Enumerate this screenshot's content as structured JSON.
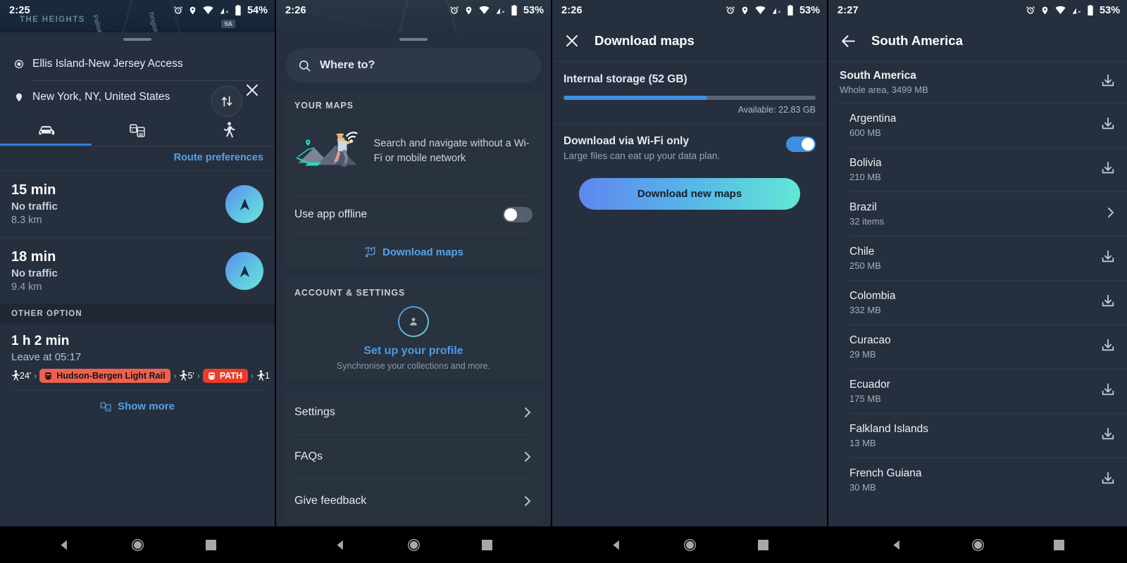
{
  "status_bars": [
    {
      "time": "2:25",
      "battery": "54%",
      "icons": [
        "alarm-icon",
        "location-icon",
        "wifi-icon",
        "cell-signal-off-icon",
        "battery-icon"
      ]
    },
    {
      "time": "2:26",
      "battery": "53%",
      "icons": [
        "alarm-icon",
        "location-icon",
        "wifi-icon",
        "cell-signal-off-icon",
        "battery-icon"
      ]
    },
    {
      "time": "2:26",
      "battery": "53%",
      "icons": [
        "alarm-icon",
        "location-icon",
        "wifi-icon",
        "cell-signal-off-icon",
        "battery-icon"
      ]
    },
    {
      "time": "2:27",
      "battery": "53%",
      "icons": [
        "alarm-icon",
        "location-icon",
        "wifi-icon",
        "cell-signal-off-icon",
        "battery-icon"
      ]
    }
  ],
  "panel1": {
    "map_labels": [
      "THE HEIGHTS"
    ],
    "map_roads": [
      "Palisade Av",
      "hington"
    ],
    "map_chip": "9A",
    "origin": "Ellis Island-New Jersey Access",
    "destination": "New York, NY, United States",
    "swap_icon": "swap-vertical-icon",
    "close_icon": "close-icon",
    "tabs": [
      {
        "name": "car-tab",
        "icon": "car-icon",
        "active": true
      },
      {
        "name": "transit-tab",
        "icon": "transit-icon",
        "active": false
      },
      {
        "name": "walk-tab",
        "icon": "walk-icon",
        "active": false
      }
    ],
    "route_preferences": "Route preferences",
    "routes": [
      {
        "time": "15 min",
        "traffic": "No traffic",
        "distance": "8.3 km",
        "go_icon": "navigation-arrow-icon"
      },
      {
        "time": "18 min",
        "traffic": "No traffic",
        "distance": "9.4 km",
        "go_icon": "navigation-arrow-icon"
      }
    ],
    "other_option_header": "OTHER OPTION",
    "transit": {
      "duration": "1 h 2 min",
      "leave": "Leave at 05:17",
      "legs": [
        {
          "type": "walk",
          "label": "24'"
        },
        {
          "type": "rail",
          "label": "Hudson-Bergen Light Rail",
          "color": "#f0604d"
        },
        {
          "type": "walk",
          "label": "5'"
        },
        {
          "type": "rail",
          "label": "PATH",
          "color": "#ee3b28"
        },
        {
          "type": "walk",
          "label": "1"
        }
      ]
    },
    "show_more": "Show more",
    "show_more_icon": "transit-map-icon"
  },
  "panel2": {
    "search_placeholder": "Where to?",
    "search_icon": "search-icon",
    "your_maps_header": "YOUR MAPS",
    "promo_text": "Search and navigate without a Wi-Fi or mobile network",
    "promo_illustration": "hiker-mountains-wifi-illustration",
    "use_app_offline": "Use app offline",
    "use_app_offline_on": false,
    "download_maps_link": "Download maps",
    "download_maps_icon": "map-download-icon",
    "account_header": "ACCOUNT & SETTINGS",
    "profile_icon": "person-icon",
    "profile_title": "Set up your profile",
    "profile_sub": "Synchronise your collections and more.",
    "nav_items": [
      {
        "label": "Settings",
        "icon": "chevron-right-icon"
      },
      {
        "label": "FAQs",
        "icon": "chevron-right-icon"
      },
      {
        "label": "Give feedback",
        "icon": "chevron-right-icon"
      }
    ]
  },
  "panel3": {
    "close_icon": "close-icon",
    "title": "Download maps",
    "storage_label": "Internal storage (52 GB)",
    "storage_used_percent": 57,
    "available": "Available: 22.83 GB",
    "wifi_title": "Download via Wi-Fi only",
    "wifi_sub": "Large files can eat up your data plan.",
    "wifi_on": true,
    "download_button": "Download new maps"
  },
  "panel4": {
    "back_icon": "arrow-back-icon",
    "title": "South America",
    "items": [
      {
        "name": "South America",
        "sub": "Whole area, 3499 MB",
        "icon": "download-icon",
        "root": true
      },
      {
        "name": "Argentina",
        "sub": "600 MB",
        "icon": "download-icon",
        "root": false
      },
      {
        "name": "Bolivia",
        "sub": "210 MB",
        "icon": "download-icon",
        "root": false
      },
      {
        "name": "Brazil",
        "sub": "32 items",
        "icon": "chevron-right-icon",
        "root": false
      },
      {
        "name": "Chile",
        "sub": "250 MB",
        "icon": "download-icon",
        "root": false
      },
      {
        "name": "Colombia",
        "sub": "332 MB",
        "icon": "download-icon",
        "root": false
      },
      {
        "name": "Curacao",
        "sub": "29 MB",
        "icon": "download-icon",
        "root": false
      },
      {
        "name": "Ecuador",
        "sub": "175 MB",
        "icon": "download-icon",
        "root": false
      },
      {
        "name": "Falkland Islands",
        "sub": "13 MB",
        "icon": "download-icon",
        "root": false
      },
      {
        "name": "French Guiana",
        "sub": "30 MB",
        "icon": "download-icon",
        "root": false
      }
    ]
  },
  "navbar": {
    "back": "back-triangle-icon",
    "home": "home-circle-icon",
    "recents": "recents-square-icon"
  },
  "colors": {
    "accent_blue": "#55a0e8",
    "sheet_bg": "#262f3d",
    "card_bg": "#29323f",
    "transit_orange": "#f0604d",
    "transit_red": "#ee3b28",
    "toggle_on": "#3d8fe0"
  }
}
